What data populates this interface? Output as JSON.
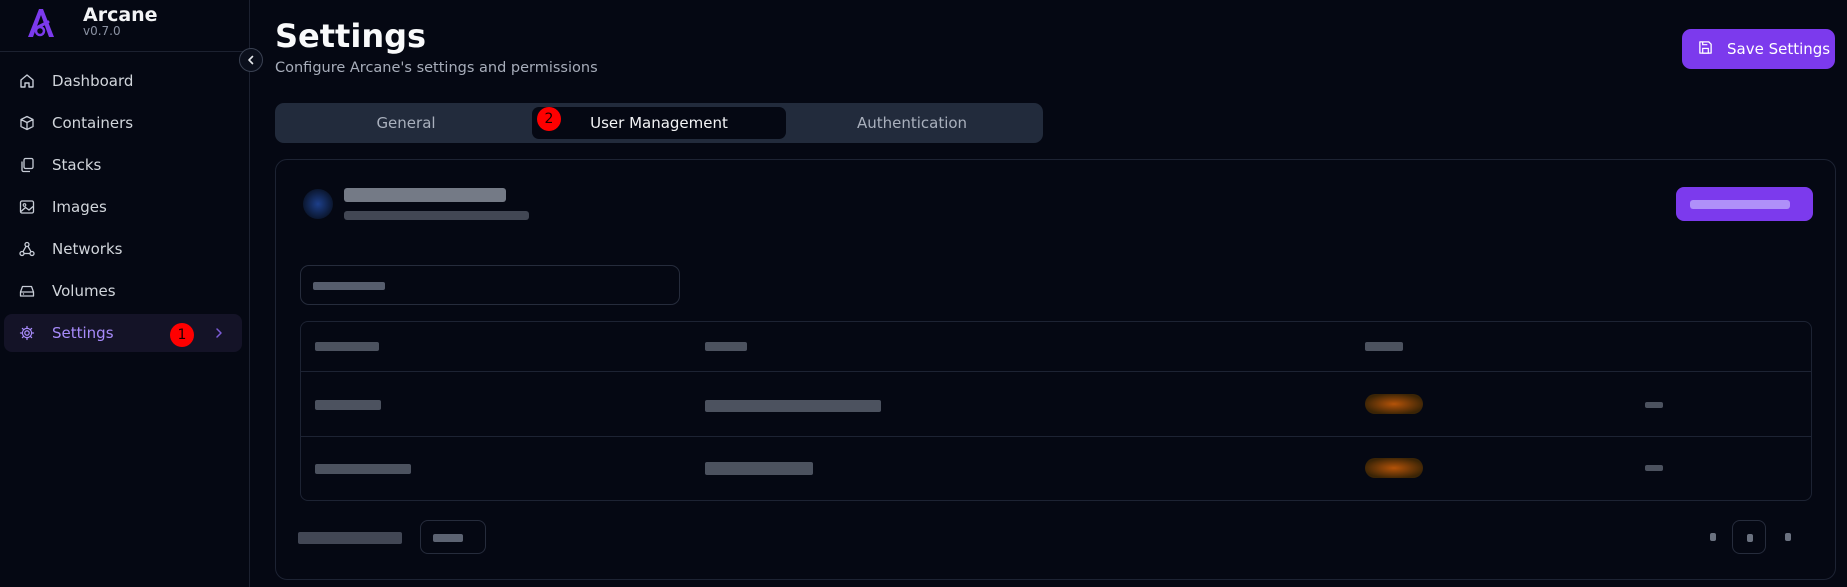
{
  "app": {
    "name": "Arcane",
    "version": "v0.7.0"
  },
  "sidebar": {
    "items": [
      {
        "label": "Dashboard",
        "icon": "home-icon"
      },
      {
        "label": "Containers",
        "icon": "box-icon"
      },
      {
        "label": "Stacks",
        "icon": "copy-icon"
      },
      {
        "label": "Images",
        "icon": "image-icon"
      },
      {
        "label": "Networks",
        "icon": "network-icon"
      },
      {
        "label": "Volumes",
        "icon": "hard-drive-icon"
      },
      {
        "label": "Settings",
        "icon": "gear-icon",
        "active": true
      }
    ]
  },
  "markers": {
    "one": "1",
    "two": "2"
  },
  "header": {
    "title": "Settings",
    "subtitle": "Configure Arcane's settings and permissions",
    "save_label": "Save Settings"
  },
  "tabs": [
    {
      "label": "General"
    },
    {
      "label": "User Management",
      "active": true
    },
    {
      "label": "Authentication"
    }
  ],
  "colors": {
    "accent": "#7c3aed",
    "active_text": "#a78bfa",
    "background": "#050813",
    "marker": "#ff0000"
  }
}
